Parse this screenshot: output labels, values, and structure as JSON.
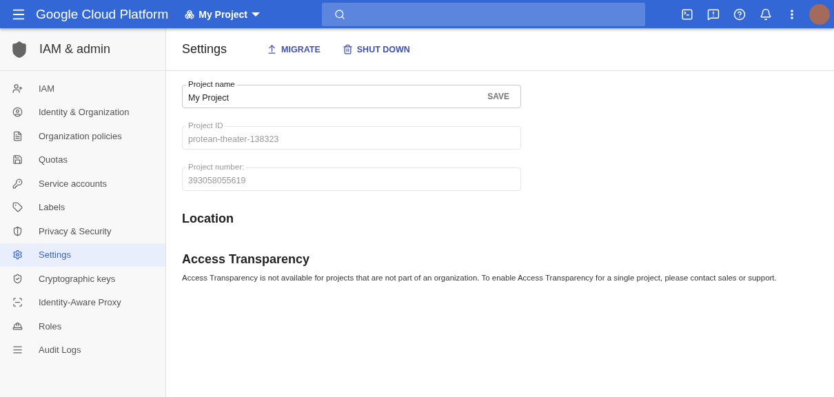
{
  "topbar": {
    "brand": "Google Cloud Platform",
    "project": "My Project"
  },
  "sidebar": {
    "title": "IAM & admin",
    "items": [
      {
        "label": "IAM",
        "selected": false
      },
      {
        "label": "Identity & Organization",
        "selected": false
      },
      {
        "label": "Organization policies",
        "selected": false
      },
      {
        "label": "Quotas",
        "selected": false
      },
      {
        "label": "Service accounts",
        "selected": false
      },
      {
        "label": "Labels",
        "selected": false
      },
      {
        "label": "Privacy & Security",
        "selected": false
      },
      {
        "label": "Settings",
        "selected": true
      },
      {
        "label": "Cryptographic keys",
        "selected": false
      },
      {
        "label": "Identity-Aware Proxy",
        "selected": false
      },
      {
        "label": "Roles",
        "selected": false
      },
      {
        "label": "Audit Logs",
        "selected": false
      }
    ]
  },
  "header": {
    "title": "Settings",
    "actions": [
      "MIGRATE",
      "SHUT DOWN"
    ]
  },
  "fields": [
    {
      "label": "Project name",
      "value": "My Project",
      "disabled": false,
      "action": "SAVE"
    },
    {
      "label": "Project ID",
      "value": "protean-theater-138323",
      "disabled": true
    },
    {
      "label": "Project number:",
      "value": "393058055619",
      "disabled": true
    }
  ],
  "sections": [
    {
      "title": "Location"
    },
    {
      "title": "Access Transparency",
      "text": "Access Transparency is not available for projects that are not part of an organization. To enable Access Transparency for a single project, please contact sales or support."
    }
  ]
}
